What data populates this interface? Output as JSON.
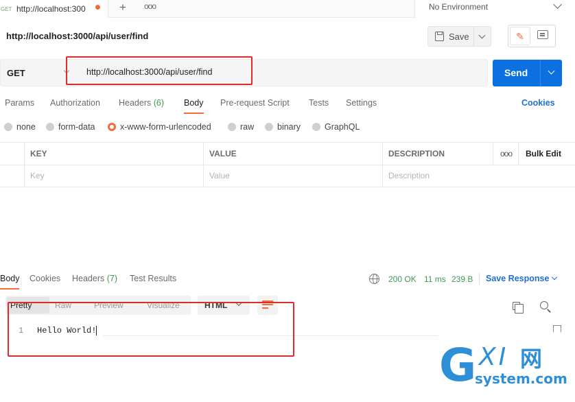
{
  "tabbar": {
    "tab_method": "GET",
    "tab_title": "http://localhost:300",
    "env_label": "No Environment"
  },
  "request": {
    "name": "http://localhost:3000/api/user/find",
    "save_label": "Save",
    "method": "GET",
    "url": "http://localhost:3000/api/user/find",
    "send_label": "Send"
  },
  "request_tabs": [
    {
      "label": "Params"
    },
    {
      "label": "Authorization"
    },
    {
      "label": "Headers",
      "count": "(6)"
    },
    {
      "label": "Body"
    },
    {
      "label": "Pre-request Script"
    },
    {
      "label": "Tests"
    },
    {
      "label": "Settings"
    }
  ],
  "cookies_link": "Cookies",
  "body_types": [
    "none",
    "form-data",
    "x-www-form-urlencoded",
    "raw",
    "binary",
    "GraphQL"
  ],
  "kv_table": {
    "headers": [
      "KEY",
      "VALUE",
      "DESCRIPTION"
    ],
    "placeholders": [
      "Key",
      "Value",
      "Description"
    ],
    "bulk_edit": "Bulk Edit",
    "more": "ooo"
  },
  "response": {
    "tabs": [
      {
        "label": "Body"
      },
      {
        "label": "Cookies"
      },
      {
        "label": "Headers",
        "count": "(7)"
      },
      {
        "label": "Test Results"
      }
    ],
    "status": "200 OK",
    "time": "11 ms",
    "size": "239 B",
    "save_response": "Save Response",
    "formats": [
      "Pretty",
      "Raw",
      "Preview",
      "Visualize"
    ],
    "language": "HTML",
    "line_number": "1",
    "content": "Hello World!"
  },
  "watermark": {
    "g": "G",
    "xi": "XI",
    "cn": "网",
    "site": "system.com"
  },
  "colors": {
    "accent": "#f26b3a",
    "send": "#0c70e0",
    "link": "#1f6fd1",
    "success": "#3d9a55",
    "highlight_box": "#e22a2a"
  }
}
